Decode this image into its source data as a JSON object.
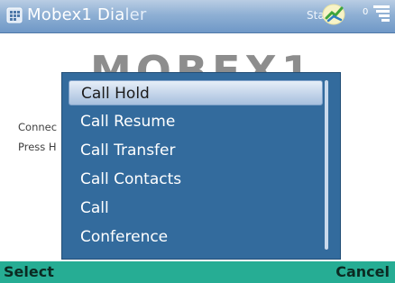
{
  "titlebar": {
    "title_main": "Mobex1 Dia",
    "title_faded": "ler",
    "status_text": "Sta",
    "battery_text": "0"
  },
  "background": {
    "logo_text": "MOBEX1",
    "line1": "Connec",
    "line2": "Press H"
  },
  "menu": {
    "items": [
      {
        "label": "Call Hold"
      },
      {
        "label": "Call Resume"
      },
      {
        "label": "Call Transfer"
      },
      {
        "label": "Call Contacts"
      },
      {
        "label": "Call"
      },
      {
        "label": "Conference"
      }
    ],
    "selected_index": 0
  },
  "softkeys": {
    "left": "Select",
    "right": "Cancel"
  },
  "colors": {
    "popup_bg": "#336b9d",
    "softkey_bg": "#26ad94",
    "titlebar_bg": "#8fb0d4"
  }
}
